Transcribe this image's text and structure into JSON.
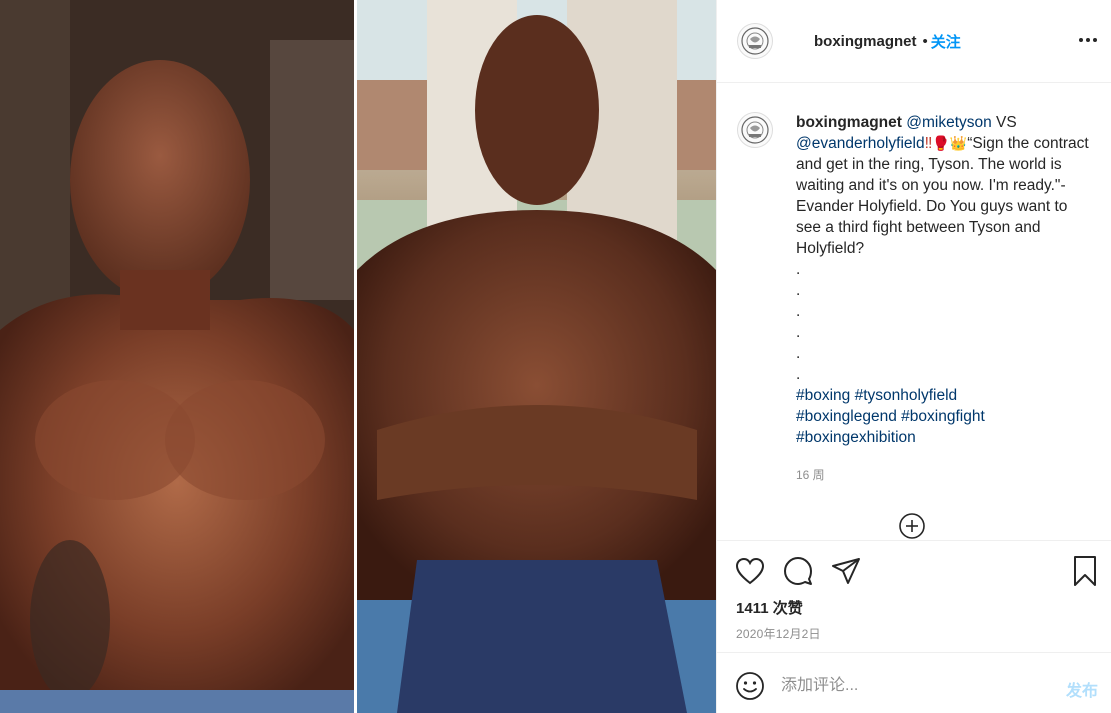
{
  "post": {
    "username": "boxingmagnet",
    "separator": "•",
    "follow_label": "关注",
    "more_icon": "more-horizontal-icon"
  },
  "caption": {
    "username": "boxingmagnet",
    "mention_1": "@miketyson",
    "vs": " VS ",
    "mention_2": "@evanderholyfield",
    "emphasis": "‼",
    "emoji_1": "🥊",
    "emoji_2": "👑",
    "text": "“Sign the contract and get in the ring, Tyson. The world is waiting and it's on you now. I'm ready.\"- Evander Holyfield. Do You guys want to see a third fight between Tyson and Holyfield?",
    "dots": [
      ".",
      ".",
      ".",
      ".",
      ".",
      "."
    ],
    "hashtags": [
      "#boxing",
      "#tysonholyfield",
      "#boxinglegend",
      "#boxingfight",
      "#boxingexhibition"
    ],
    "time": "16 周"
  },
  "actions": {
    "like_icon": "heart-icon",
    "comment_icon": "comment-icon",
    "share_icon": "paper-plane-icon",
    "save_icon": "bookmark-icon",
    "likes_text": "1411 次赞",
    "date": "2020年12月2日"
  },
  "comment_box": {
    "placeholder": "添加评论...",
    "post_label": "发布",
    "emoji_icon": "smile-icon"
  },
  "colors": {
    "accent": "#0095f6",
    "link": "#00376b",
    "muted": "#8e8e8e",
    "post_disabled": "#b2dffc"
  }
}
